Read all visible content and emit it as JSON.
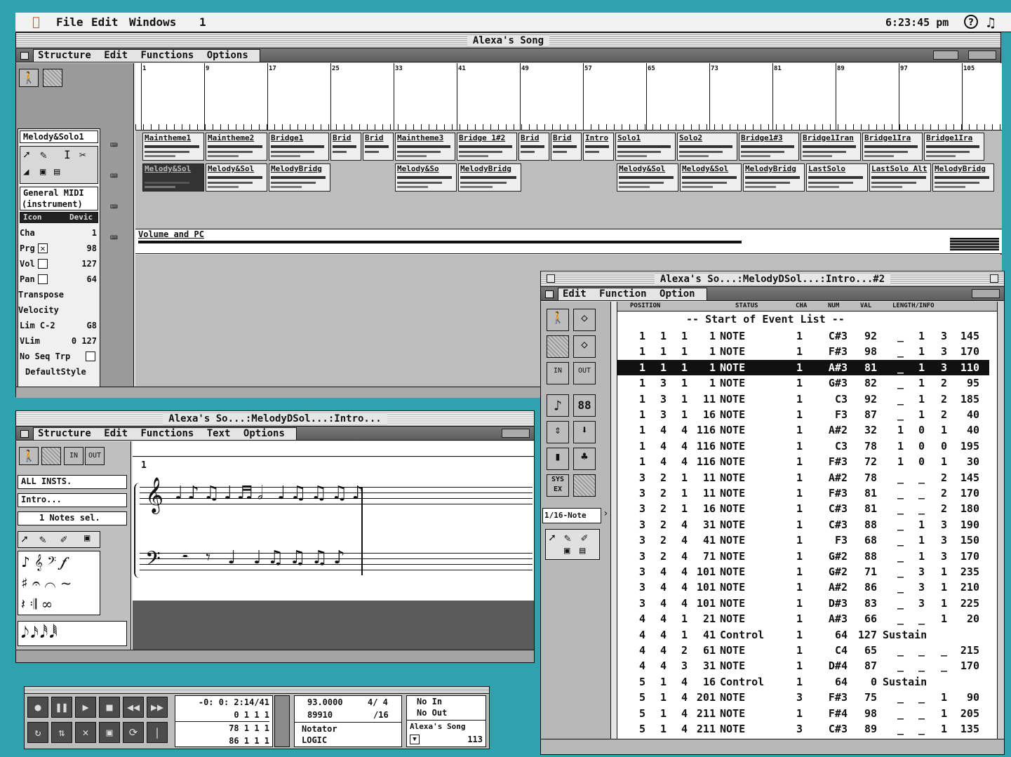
{
  "menubar": {
    "apple": "",
    "items": [
      "File",
      "Edit",
      "Windows",
      "1"
    ],
    "clock": "6:23:45 pm"
  },
  "arrange": {
    "title": "Alexa's Song",
    "menu": [
      "Structure",
      "Edit",
      "Functions",
      "Options"
    ],
    "bar_numbers": [
      "1",
      "9",
      "17",
      "25",
      "33",
      "41",
      "49",
      "57",
      "65",
      "73",
      "81",
      "89",
      "97",
      "105"
    ],
    "track1_regions": [
      "Maintheme1",
      "Maintheme2",
      "Bridge1",
      "Brid",
      "Brid",
      "Maintheme3",
      "Bridge 1#2",
      "Brid",
      "Brid",
      "Intro",
      "Solo1",
      "Solo2",
      "Bridge1#3",
      "Bridge1Iran",
      "Bridge1Ira",
      "Bridge1Ira"
    ],
    "track2_regions": [
      "Melody&Sol",
      "Melody&Sol",
      "MelodyBridg",
      "Melody&So",
      "MelodyBridg",
      "Melody&Sol",
      "Melody&Sol",
      "MelodyBridg",
      "LastSolo",
      "LastSolo Alt",
      "MelodyBridg"
    ],
    "inspector": {
      "track_name": "Melody&Solo1",
      "instrument_line1": "General MIDI",
      "instrument_line2": "(instrument)",
      "icon_label": "Icon",
      "dev_label": "Devic",
      "rows": [
        {
          "label": "Cha",
          "value": "1"
        },
        {
          "label": "Prg",
          "value": "98"
        },
        {
          "label": "Vol",
          "value": "127"
        },
        {
          "label": "Pan",
          "value": "64"
        },
        {
          "label": "Transpose",
          "value": ""
        },
        {
          "label": "Velocity",
          "value": ""
        },
        {
          "label": "Lim  C-2",
          "value": "G8"
        },
        {
          "label": "VLim",
          "value": "0 127"
        },
        {
          "label": "No Seq Trp",
          "value": ""
        },
        {
          "label": "DefaultStyle",
          "value": ""
        }
      ]
    },
    "volume_lane": "Volume and PC"
  },
  "score": {
    "title": "Alexa's So...:MelodyDSol...:Intro...",
    "menu": [
      "Structure",
      "Edit",
      "Functions",
      "Text",
      "Options"
    ],
    "fields": [
      "ALL INSTS.",
      "Intro...",
      "1 Notes sel."
    ],
    "bar_number": "1"
  },
  "event_list": {
    "title": "Alexa's So...:MelodyDSol...:Intro...#2",
    "menu": [
      "Edit",
      "Function",
      "Option"
    ],
    "headers": [
      "POSITION",
      "STATUS",
      "CHA",
      "NUM",
      "VAL",
      "LENGTH/INFO"
    ],
    "start_label": "-- Start of Event List --",
    "quantize": "1/16-Note",
    "selected_index": 2,
    "rows": [
      [
        "1",
        "1",
        "1",
        "1",
        "NOTE",
        "1",
        "C#3",
        "92",
        "_",
        "1",
        "3",
        "145"
      ],
      [
        "1",
        "1",
        "1",
        "1",
        "NOTE",
        "1",
        "F#3",
        "98",
        "_",
        "1",
        "3",
        "170"
      ],
      [
        "1",
        "1",
        "1",
        "1",
        "NOTE",
        "1",
        "A#3",
        "81",
        "_",
        "1",
        "3",
        "110"
      ],
      [
        "1",
        "3",
        "1",
        "1",
        "NOTE",
        "1",
        "G#3",
        "82",
        "_",
        "1",
        "2",
        "95"
      ],
      [
        "1",
        "3",
        "1",
        "11",
        "NOTE",
        "1",
        "C3",
        "92",
        "_",
        "1",
        "2",
        "185"
      ],
      [
        "1",
        "3",
        "1",
        "16",
        "NOTE",
        "1",
        "F3",
        "87",
        "_",
        "1",
        "2",
        "40"
      ],
      [
        "1",
        "4",
        "4",
        "116",
        "NOTE",
        "1",
        "A#2",
        "32",
        "1",
        "0",
        "1",
        "40"
      ],
      [
        "1",
        "4",
        "4",
        "116",
        "NOTE",
        "1",
        "C3",
        "78",
        "1",
        "0",
        "0",
        "195"
      ],
      [
        "1",
        "4",
        "4",
        "116",
        "NOTE",
        "1",
        "F#3",
        "72",
        "1",
        "0",
        "1",
        "30"
      ],
      [
        "3",
        "2",
        "1",
        "11",
        "NOTE",
        "1",
        "A#2",
        "78",
        "_",
        "_",
        "2",
        "145"
      ],
      [
        "3",
        "2",
        "1",
        "11",
        "NOTE",
        "1",
        "F#3",
        "81",
        "_",
        "_",
        "2",
        "170"
      ],
      [
        "3",
        "2",
        "1",
        "16",
        "NOTE",
        "1",
        "C#3",
        "81",
        "_",
        "_",
        "2",
        "180"
      ],
      [
        "3",
        "2",
        "4",
        "31",
        "NOTE",
        "1",
        "C#3",
        "88",
        "_",
        "1",
        "3",
        "190"
      ],
      [
        "3",
        "2",
        "4",
        "41",
        "NOTE",
        "1",
        "F3",
        "68",
        "_",
        "1",
        "3",
        "150"
      ],
      [
        "3",
        "2",
        "4",
        "71",
        "NOTE",
        "1",
        "G#2",
        "88",
        "_",
        "1",
        "3",
        "170"
      ],
      [
        "3",
        "4",
        "4",
        "101",
        "NOTE",
        "1",
        "G#2",
        "71",
        "_",
        "3",
        "1",
        "235"
      ],
      [
        "3",
        "4",
        "4",
        "101",
        "NOTE",
        "1",
        "A#2",
        "86",
        "_",
        "3",
        "1",
        "210"
      ],
      [
        "3",
        "4",
        "4",
        "101",
        "NOTE",
        "1",
        "D#3",
        "83",
        "_",
        "3",
        "1",
        "225"
      ],
      [
        "4",
        "4",
        "1",
        "21",
        "NOTE",
        "1",
        "A#3",
        "66",
        "_",
        "_",
        "1",
        "20"
      ],
      [
        "4",
        "4",
        "1",
        "41",
        "Control",
        "1",
        "64",
        "127",
        "Sustain",
        "",
        "",
        ""
      ],
      [
        "4",
        "4",
        "2",
        "61",
        "NOTE",
        "1",
        "C4",
        "65",
        "_",
        "_",
        "_",
        "215"
      ],
      [
        "4",
        "4",
        "3",
        "31",
        "NOTE",
        "1",
        "D#4",
        "87",
        "_",
        "_",
        "_",
        "170"
      ],
      [
        "5",
        "1",
        "4",
        "16",
        "Control",
        "1",
        "64",
        "0",
        "Sustain",
        "",
        "",
        ""
      ],
      [
        "5",
        "1",
        "4",
        "201",
        "NOTE",
        "3",
        "F#3",
        "75",
        "_",
        "_",
        "1",
        "90"
      ],
      [
        "5",
        "1",
        "4",
        "211",
        "NOTE",
        "1",
        "F#4",
        "98",
        "_",
        "_",
        "1",
        "205"
      ],
      [
        "5",
        "1",
        "4",
        "211",
        "NOTE",
        "3",
        "C#3",
        "89",
        "_",
        "_",
        "1",
        "135"
      ]
    ]
  },
  "transport": {
    "smpte": "-0: 0: 2:14/41",
    "position": "0  1  1  1",
    "second_line": "78  1  1  1",
    "third_line": "86  1  1  1",
    "tempo": "93.0000",
    "ticks": "89910",
    "signature_top": "4/ 4",
    "signature_bottom": "/16",
    "notator": "Notator",
    "logic": "LOGIC",
    "midi_in": "No In",
    "midi_out": "No Out",
    "song_name": "Alexa's Song",
    "song_number": "113"
  }
}
